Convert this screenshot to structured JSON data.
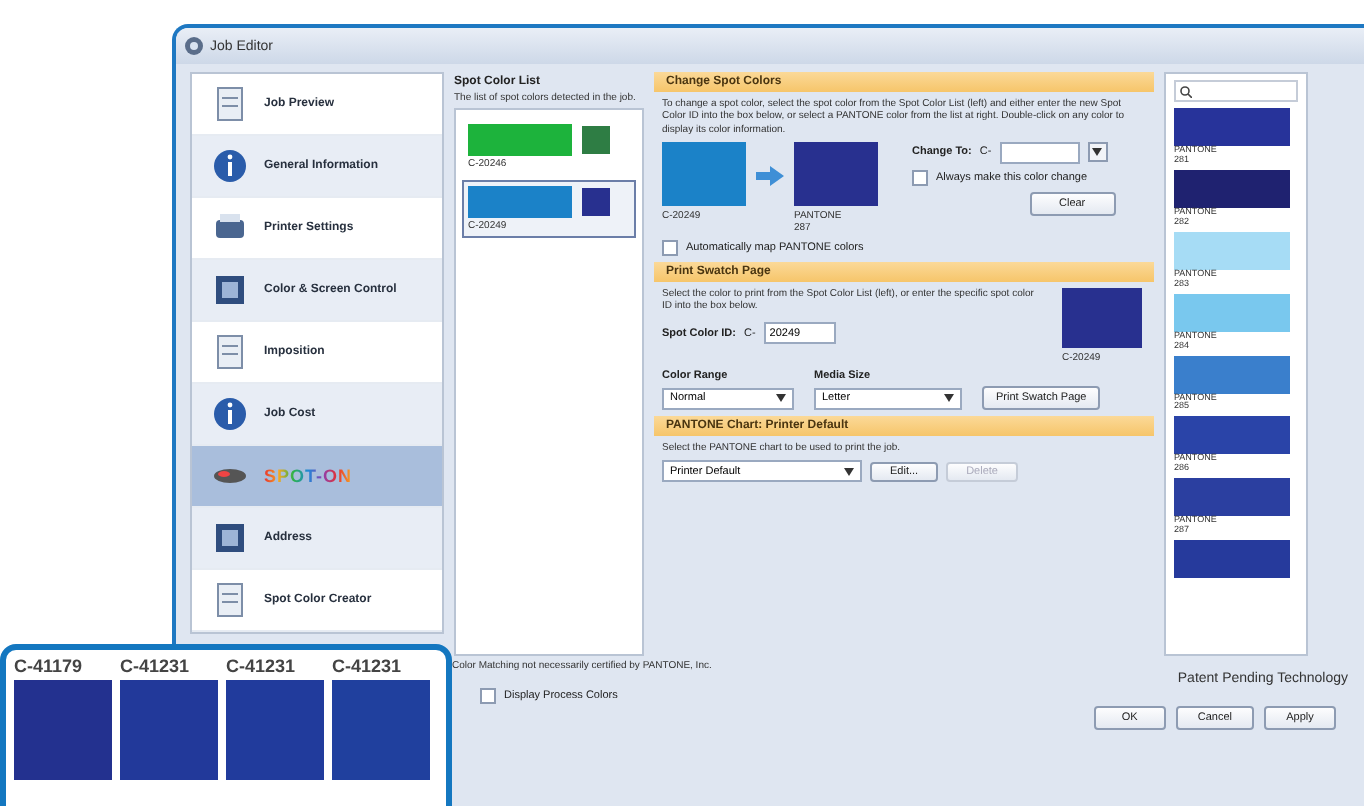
{
  "window": {
    "title": "Job Editor"
  },
  "sidebar": {
    "items": [
      {
        "label": "Job Preview",
        "selected": false,
        "kind": "icon"
      },
      {
        "label": "General Information",
        "selected": false,
        "kind": "icon"
      },
      {
        "label": "Printer Settings",
        "selected": false,
        "kind": "icon"
      },
      {
        "label": "Color & Screen Control",
        "selected": false,
        "kind": "icon"
      },
      {
        "label": "Imposition",
        "selected": false,
        "kind": "icon"
      },
      {
        "label": "Job Cost",
        "selected": false,
        "kind": "icon"
      },
      {
        "label": "SPOT-ON",
        "selected": true,
        "kind": "logo"
      },
      {
        "label": "Address",
        "selected": false,
        "kind": "icon"
      },
      {
        "label": "Spot Color Creator",
        "selected": false,
        "kind": "icon"
      }
    ]
  },
  "spot_color_list": {
    "title": "Spot Color List",
    "description": "The list of spot colors detected in the job.",
    "items": [
      {
        "label": "C-20246",
        "color": "#1db33c",
        "mapped": {
          "color": "#2e7d44"
        },
        "selected": false
      },
      {
        "label": "C-20249",
        "color": "#1b82c8",
        "mapped": {
          "color": "#28308f"
        },
        "selected": true
      }
    ]
  },
  "change_spot_colors": {
    "title": "Change Spot Colors",
    "description": "To change a spot color, select the spot color from the Spot Color List (left) and either enter the new Spot Color ID into the box below, or select a PANTONE color from the list at right. Double-click on any color to display its color information.",
    "from_label": "C-20249",
    "to_label": "PANTONE 287",
    "change_to_label": "Change To:",
    "prefix": "C-",
    "always_change": {
      "label": "Always make this color change",
      "checked": false
    },
    "clear_button": "Clear",
    "auto_map": {
      "label": "Automatically map PANTONE colors",
      "checked": false
    }
  },
  "print_swatch": {
    "title": "Print Swatch Page",
    "description": "Select the color to print from the Spot Color List (left), or enter the specific spot color ID into the box below.",
    "id_label": "Spot Color ID:",
    "prefix": "C-",
    "id_value": "20249",
    "swatch_label": "C-20249",
    "color_range_label": "Color Range",
    "color_range_value": "Normal",
    "media_size_label": "Media Size",
    "media_size_value": "Letter",
    "print_button": "Print Swatch Page"
  },
  "pantone_chart": {
    "title": "PANTONE Chart: Printer Default",
    "description": "Select the PANTONE chart to be used to print the job.",
    "value": "Printer Default",
    "edit_button": "Edit...",
    "delete_button": {
      "label": "Delete",
      "disabled": true
    }
  },
  "footer_note": "Color Matching not necessarily certified by PANTONE, Inc.",
  "patent_text": "Patent Pending Technology",
  "display_process": {
    "label": "Display Process Colors",
    "checked": false
  },
  "buttons": [
    "OK",
    "Cancel",
    "Apply"
  ],
  "pantone_list": {
    "items": [
      {
        "color": "#27339a",
        "name": "PANTONE",
        "number": "281"
      },
      {
        "color": "#1f2270",
        "name": "PANTONE",
        "number": "282"
      },
      {
        "color": "#a6dcf5",
        "name": "PANTONE",
        "number": "283"
      },
      {
        "color": "#79c8ee",
        "name": "PANTONE",
        "number": "284"
      },
      {
        "color": "#3a7fcc",
        "name": "PANTONE",
        "number": "285"
      },
      {
        "color": "#2a44a8",
        "name": "PANTONE",
        "number": "286"
      },
      {
        "color": "#2b3fa0",
        "name": "PANTONE",
        "number": "287"
      },
      {
        "color": "#263a9c"
      }
    ]
  },
  "inset": {
    "swatches": [
      {
        "label": "C-41179",
        "color": "#23318f"
      },
      {
        "label": "C-41231",
        "color": "#22399a"
      },
      {
        "label": "C-41231",
        "color": "#213b9c"
      },
      {
        "label": "C-41231",
        "color": "#20409e"
      }
    ]
  }
}
